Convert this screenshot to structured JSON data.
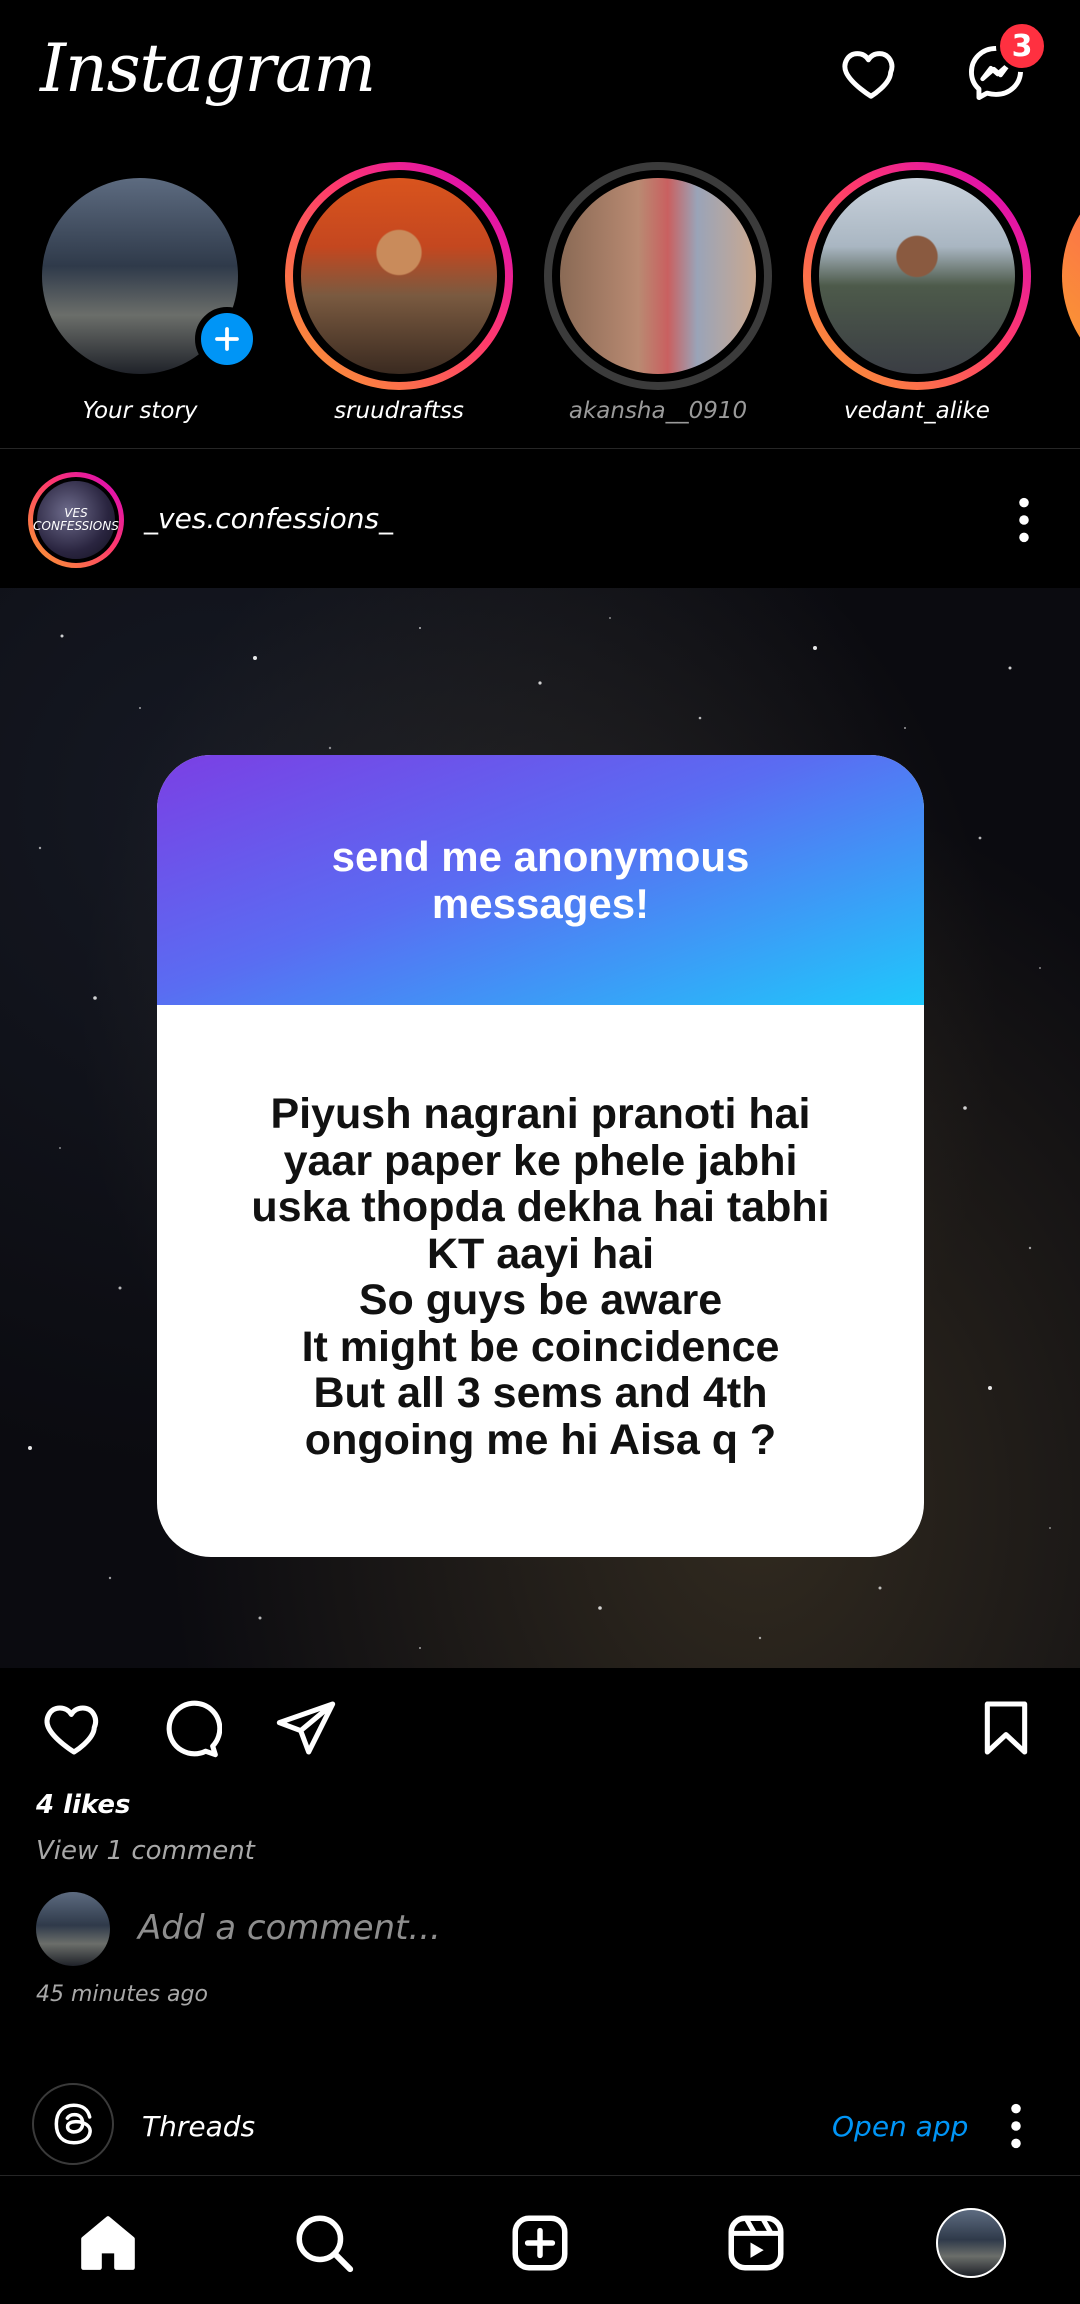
{
  "header": {
    "app_name": "Instagram",
    "notifications_icon": "heart-icon",
    "messenger_icon": "messenger-icon",
    "messenger_badge": "3"
  },
  "stories": [
    {
      "username": "Your story",
      "seen": false,
      "is_own": true
    },
    {
      "username": "sruudraftss",
      "seen": false
    },
    {
      "username": "akansha__0910",
      "seen": true
    },
    {
      "username": "vedant_alike",
      "seen": false
    }
  ],
  "post": {
    "username": "_ves.confessions_",
    "avatar_text": "VES\nCONFESSIONS",
    "card_title": "send me anonymous\nmessages!",
    "card_message": "Piyush nagrani pranoti hai\nyaar paper ke phele jabhi\nuska thopda dekha hai tabhi\nKT aayi hai\nSo guys be aware\nIt might be coincidence\nBut all 3 sems and 4th\nongoing me hi Aisa q ?",
    "likes": "4 likes",
    "view_comments": "View 1 comment",
    "comment_placeholder": "Add a comment...",
    "timestamp": "45 minutes ago"
  },
  "threads": {
    "label": "Threads",
    "action": "Open app"
  },
  "colors": {
    "background": "#000000",
    "accent_blue": "#0095f6",
    "badge_red": "#ff3040"
  }
}
